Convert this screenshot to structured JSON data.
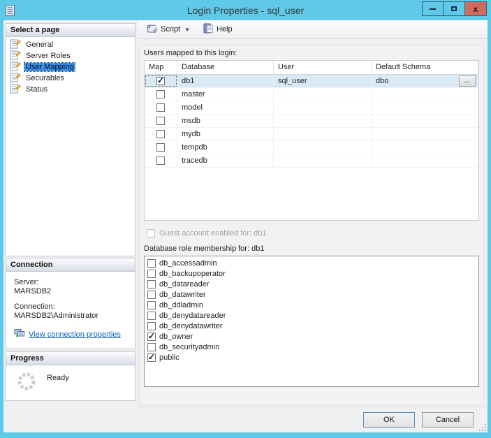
{
  "window": {
    "title": "Login Properties - sql_user",
    "controls": {
      "minimize": "minimize",
      "maximize": "maximize",
      "close": "close"
    }
  },
  "colors": {
    "titlebar": "#5fc9e9",
    "close_button": "#d16b5e",
    "selection": "#3a8ce0",
    "selected_row": "#d9eaf7",
    "link": "#0563c1"
  },
  "sidebar": {
    "select_page": {
      "header": "Select a page",
      "items": [
        {
          "label": "General",
          "selected": false
        },
        {
          "label": "Server Roles",
          "selected": false
        },
        {
          "label": "User Mapping",
          "selected": true
        },
        {
          "label": "Securables",
          "selected": false
        },
        {
          "label": "Status",
          "selected": false
        }
      ]
    },
    "connection": {
      "header": "Connection",
      "server_label": "Server:",
      "server_value": "MARSDB2",
      "connection_label": "Connection:",
      "connection_value": "MARSDB2\\Administrator",
      "link_label": "View connection properties"
    },
    "progress": {
      "header": "Progress",
      "status": "Ready"
    }
  },
  "toolbar": {
    "script_label": "Script",
    "help_label": "Help"
  },
  "main": {
    "users_label": "Users mapped to this login:",
    "table": {
      "columns": [
        "Map",
        "Database",
        "User",
        "Default Schema"
      ],
      "ellipsis_label": "...",
      "rows": [
        {
          "map": true,
          "database": "db1",
          "user": "sql_user",
          "default_schema": "dbo",
          "selected": true,
          "ellipsis": true
        },
        {
          "map": false,
          "database": "master",
          "user": "",
          "default_schema": "",
          "selected": false,
          "ellipsis": false
        },
        {
          "map": false,
          "database": "model",
          "user": "",
          "default_schema": "",
          "selected": false,
          "ellipsis": false
        },
        {
          "map": false,
          "database": "msdb",
          "user": "",
          "default_schema": "",
          "selected": false,
          "ellipsis": false
        },
        {
          "map": false,
          "database": "mydb",
          "user": "",
          "default_schema": "",
          "selected": false,
          "ellipsis": false
        },
        {
          "map": false,
          "database": "tempdb",
          "user": "",
          "default_schema": "",
          "selected": false,
          "ellipsis": false
        },
        {
          "map": false,
          "database": "tracedb",
          "user": "",
          "default_schema": "",
          "selected": false,
          "ellipsis": false
        }
      ]
    },
    "guest": {
      "label": "Guest account enabled for: db1",
      "checked": false,
      "enabled": false
    },
    "roles_label": "Database role membership for: db1",
    "roles": [
      {
        "name": "db_accessadmin",
        "checked": false
      },
      {
        "name": "db_backupoperator",
        "checked": false
      },
      {
        "name": "db_datareader",
        "checked": false
      },
      {
        "name": "db_datawriter",
        "checked": false
      },
      {
        "name": "db_ddladmin",
        "checked": false
      },
      {
        "name": "db_denydatareader",
        "checked": false
      },
      {
        "name": "db_denydatawriter",
        "checked": false
      },
      {
        "name": "db_owner",
        "checked": true
      },
      {
        "name": "db_securityadmin",
        "checked": false
      },
      {
        "name": "public",
        "checked": true
      }
    ]
  },
  "footer": {
    "ok_label": "OK",
    "cancel_label": "Cancel"
  }
}
